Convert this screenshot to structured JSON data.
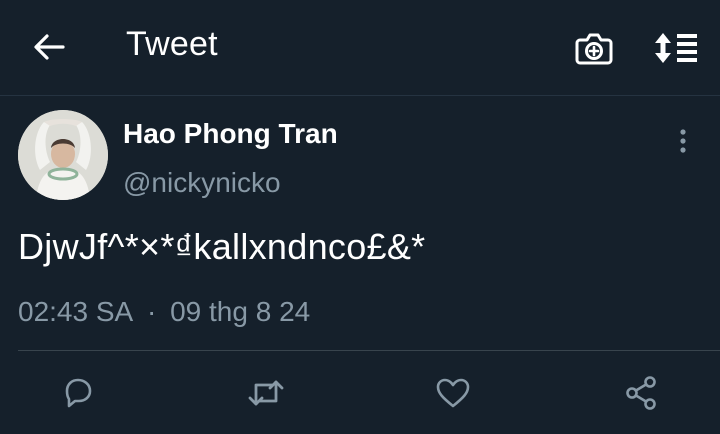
{
  "header": {
    "title": "Tweet",
    "icons": {
      "back": "arrow-left-icon",
      "camera": "camera-plus-icon",
      "sort": "sort-list-icon"
    }
  },
  "tweet": {
    "author": {
      "display_name": "Hao Phong Tran",
      "handle": "@nickynicko"
    },
    "text": "DjwJf^*×*₫kallxndnco£&*",
    "time": "02:43 SA",
    "separator": "·",
    "date": "09 thg 8 24"
  },
  "actions": [
    {
      "icon": "reply-icon"
    },
    {
      "icon": "retweet-icon"
    },
    {
      "icon": "like-heart-icon"
    },
    {
      "icon": "share-icon"
    }
  ],
  "colors": {
    "background": "#15202b",
    "text_primary": "#ffffff",
    "text_secondary": "#8899a6",
    "divider": "#38444d"
  }
}
